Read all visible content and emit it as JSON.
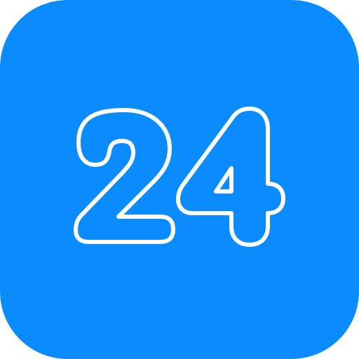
{
  "icon": {
    "name": "number-24-icon",
    "text": "24",
    "colors": {
      "background": "#0A8CFF",
      "stroke": "#FFFFFF"
    }
  }
}
